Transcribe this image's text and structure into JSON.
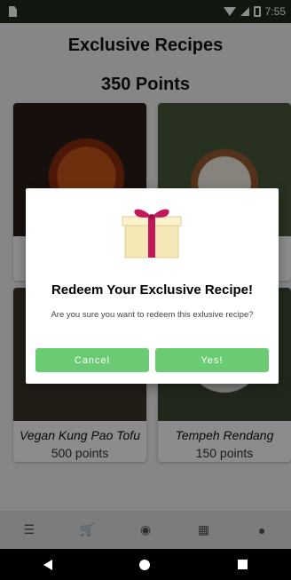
{
  "status_bar": {
    "time": "7:55"
  },
  "header": {
    "title": "Exclusive Recipes",
    "points": "350 Points"
  },
  "recipes": [
    {
      "name": "",
      "points": ""
    },
    {
      "name": "",
      "points": ""
    },
    {
      "name": "Vegan Kung Pao Tofu",
      "points": "500 points"
    },
    {
      "name": "Tempeh Rendang",
      "points": "150 points"
    }
  ],
  "dialog": {
    "title": "Redeem Your Exclusive Recipe!",
    "message": "Are you sure you want to redeem this exlusive recipe?",
    "cancel_label": "Cancel",
    "confirm_label": "Yes!"
  },
  "colors": {
    "accent_green": "#6bcb72",
    "ribbon": "#c2185b",
    "gift": "#f6e8b6"
  }
}
